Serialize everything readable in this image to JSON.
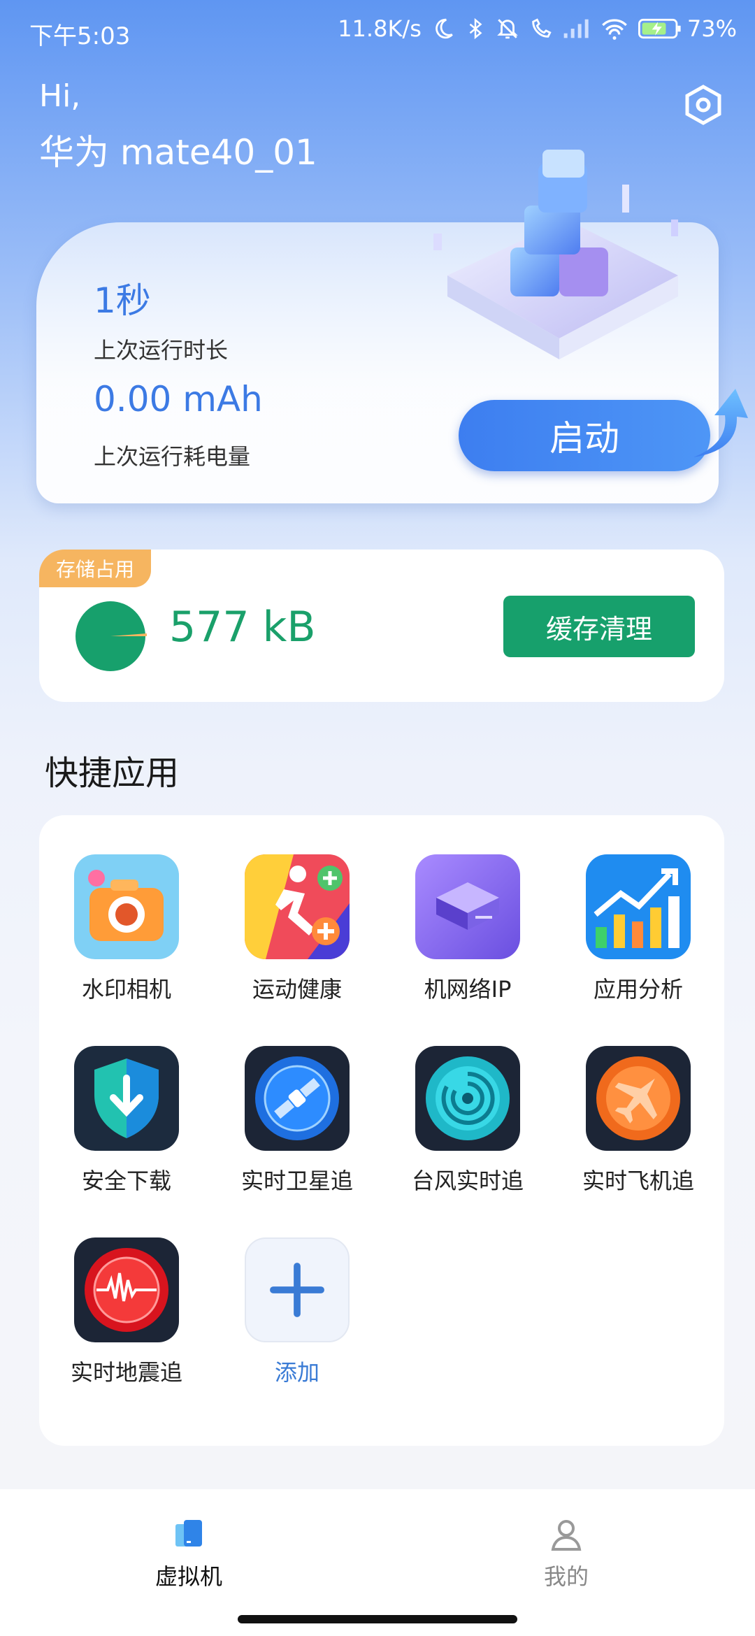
{
  "status_bar": {
    "time": "下午5:03",
    "net_speed": "11.8K/s",
    "battery": "73%"
  },
  "header": {
    "greeting": "Hi,",
    "device_name": "华为 mate40_01"
  },
  "run_card": {
    "duration_value": "1秒",
    "duration_label": "上次运行时长",
    "power_value": "0.00 mAh",
    "power_label": "上次运行耗电量",
    "start_label": "启动"
  },
  "storage": {
    "tag": "存储占用",
    "size": "577 kB",
    "clean_label": "缓存清理"
  },
  "quick_apps": {
    "title": "快捷应用",
    "items": [
      {
        "label": "水印相机",
        "icon": "camera-icon"
      },
      {
        "label": "运动健康",
        "icon": "running-icon"
      },
      {
        "label": "机网络IP",
        "icon": "network-box-icon"
      },
      {
        "label": "应用分析",
        "icon": "chart-icon"
      },
      {
        "label": "安全下载",
        "icon": "shield-download-icon"
      },
      {
        "label": "实时卫星追",
        "icon": "satellite-icon"
      },
      {
        "label": "台风实时追",
        "icon": "typhoon-icon"
      },
      {
        "label": "实时飞机追",
        "icon": "airplane-icon"
      },
      {
        "label": "实时地震追",
        "icon": "earthquake-icon"
      },
      {
        "label": "添加",
        "icon": "plus-icon"
      }
    ]
  },
  "tabbar": {
    "tabs": [
      {
        "label": "虚拟机",
        "active": true
      },
      {
        "label": "我的",
        "active": false
      }
    ]
  },
  "colors": {
    "accent_blue": "#3c7ae4",
    "green": "#17a06c",
    "tag_orange": "#f6b560"
  }
}
